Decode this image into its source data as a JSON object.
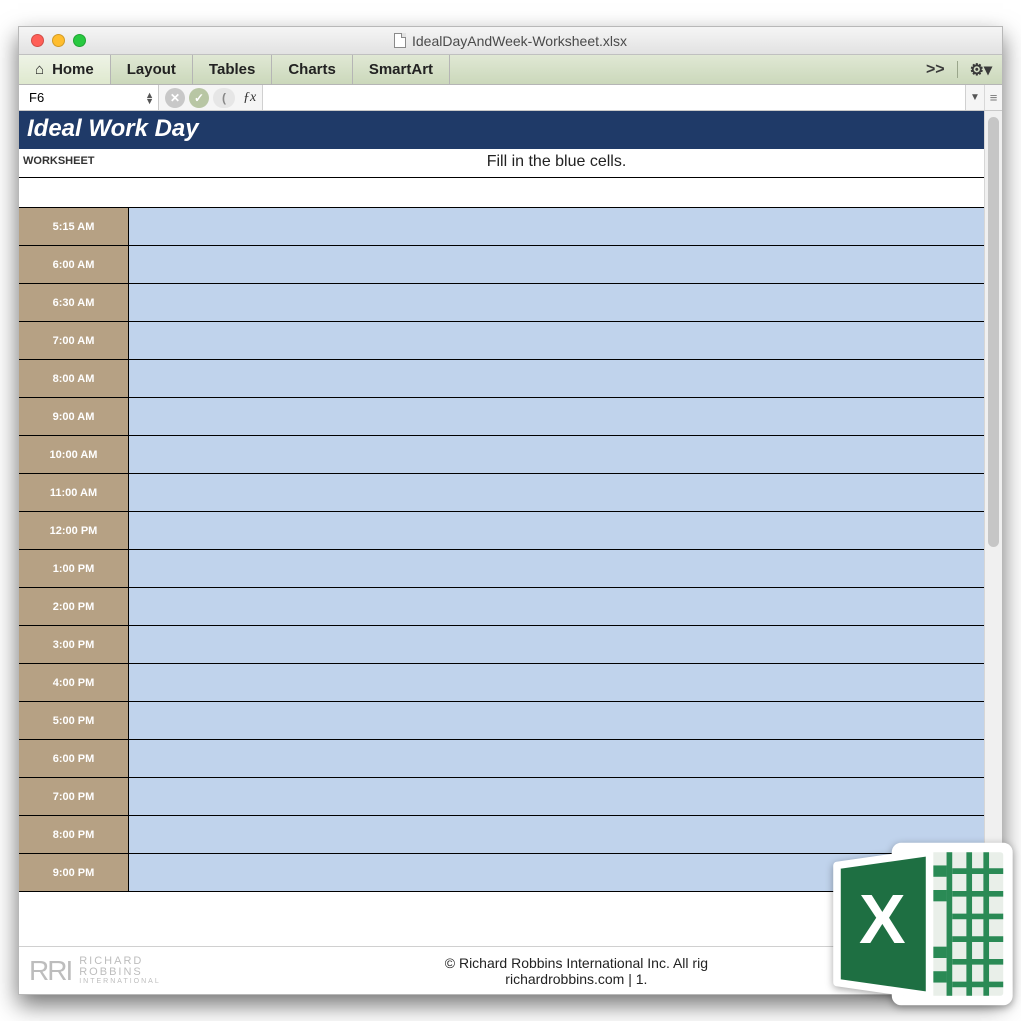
{
  "window": {
    "title": "IdealDayAndWeek-Worksheet.xlsx"
  },
  "ribbon": {
    "tabs": {
      "home": "Home",
      "layout": "Layout",
      "tables": "Tables",
      "charts": "Charts",
      "smartart": "SmartArt"
    }
  },
  "formulabar": {
    "cell_ref": "F6",
    "fx_label": "ƒx",
    "value": ""
  },
  "sheet": {
    "title": "Ideal Work Day",
    "worksheet_label": "WORKSHEET",
    "instruction": "Fill in the blue cells.",
    "times": [
      "5:15 AM",
      "6:00 AM",
      "6:30 AM",
      "7:00 AM",
      "8:00 AM",
      "9:00 AM",
      "10:00 AM",
      "11:00 AM",
      "12:00 PM",
      "1:00 PM",
      "2:00 PM",
      "3:00 PM",
      "4:00 PM",
      "5:00 PM",
      "6:00 PM",
      "7:00 PM",
      "8:00 PM",
      "9:00 PM"
    ]
  },
  "footer": {
    "logo_mark": "RRI",
    "logo_line1": "RICHARD",
    "logo_line2": "ROBBINS",
    "logo_line3": "INTERNATIONAL",
    "copyright": "© Richard Robbins International Inc. All rig",
    "website": "richardrobbins.com  |  1."
  },
  "colors": {
    "ribbon_bg": "#d6e2c4",
    "title_bar": "#1f3a68",
    "time_col": "#b6a184",
    "blue_cell": "#c0d3ec",
    "excel_green": "#1e6f42"
  }
}
